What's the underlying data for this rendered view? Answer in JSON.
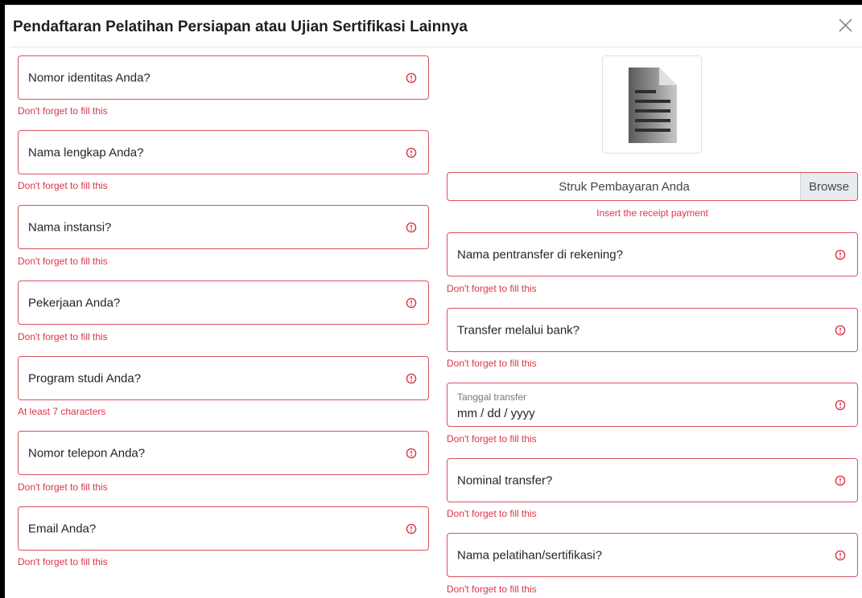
{
  "modal": {
    "title": "Pendaftaran Pelatihan Persiapan atau Ujian Sertifikasi Lainnya"
  },
  "left_fields": [
    {
      "label": "Nomor identitas Anda?",
      "error": "Don't forget to fill this"
    },
    {
      "label": "Nama lengkap Anda?",
      "error": "Don't forget to fill this"
    },
    {
      "label": "Nama instansi?",
      "error": "Don't forget to fill this"
    },
    {
      "label": "Pekerjaan Anda?",
      "error": "Don't forget to fill this"
    },
    {
      "label": "Program studi Anda?",
      "error": "At least 7 characters"
    },
    {
      "label": "Nomor telepon Anda?",
      "error": "Don't forget to fill this"
    },
    {
      "label": "Email Anda?",
      "error": "Don't forget to fill this"
    }
  ],
  "receipt": {
    "file_label": "Struk Pembayaran Anda",
    "browse_label": "Browse",
    "error": "Insert the receipt payment"
  },
  "right_fields": [
    {
      "label": "Nama pentransfer di rekening?",
      "error": "Don't forget to fill this"
    },
    {
      "label": "Transfer melalui bank?",
      "error": "Don't forget to fill this"
    },
    {
      "label": "Tanggal transfer",
      "value": "mm / dd / yyyy",
      "error": "Don't forget to fill this"
    },
    {
      "label": "Nominal transfer?",
      "error": "Don't forget to fill this"
    },
    {
      "label": "Nama pelatihan/sertifikasi?",
      "error": "Don't forget to fill this"
    }
  ],
  "colors": {
    "error": "#d9364a",
    "field_border": "#d9515f"
  },
  "icons": {
    "close": "close-icon",
    "error": "exclamation-circle-icon",
    "document": "document-icon"
  }
}
